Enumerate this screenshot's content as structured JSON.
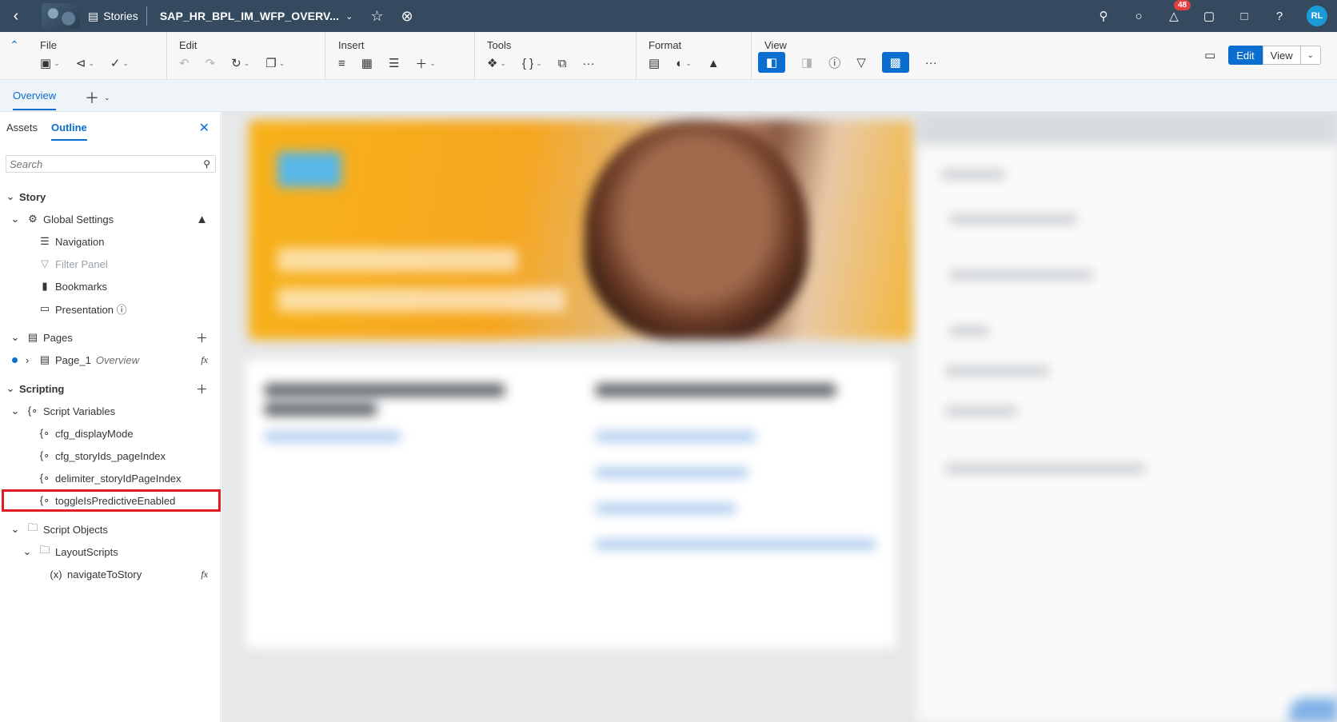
{
  "shell": {
    "stories_label": "Stories",
    "doc_title": "SAP_HR_BPL_IM_WFP_OVERV...",
    "notifications_count": "48",
    "avatar_initials": "RL"
  },
  "toolbar": {
    "groups": {
      "file": "File",
      "edit": "Edit",
      "insert": "Insert",
      "tools": "Tools",
      "format": "Format",
      "view": "View"
    },
    "mode": {
      "edit": "Edit",
      "view": "View"
    }
  },
  "page_tabs": {
    "active": "Overview"
  },
  "panel": {
    "tabs": {
      "assets": "Assets",
      "outline": "Outline"
    },
    "search_placeholder": "Search",
    "tree": {
      "story": "Story",
      "global_settings": "Global Settings",
      "navigation": "Navigation",
      "filter_panel": "Filter Panel",
      "bookmarks": "Bookmarks",
      "presentation": "Presentation",
      "pages": "Pages",
      "page_1": "Page_1",
      "page_1_sub": "Overview",
      "scripting": "Scripting",
      "script_variables": "Script Variables",
      "var_1": "cfg_displayMode",
      "var_2": "cfg_storyIds_pageIndex",
      "var_3": "delimiter_storyIdPageIndex",
      "var_4": "toggleIsPredictiveEnabled",
      "script_objects": "Script Objects",
      "layout_scripts": "LayoutScripts",
      "navigate_to_story": "navigateToStory"
    },
    "fx_label": "fx"
  },
  "colors": {
    "shell_bg": "#354a5f",
    "accent": "#0a6ed1",
    "highlight_box": "#e01d22",
    "badge": "#e33f3f"
  }
}
